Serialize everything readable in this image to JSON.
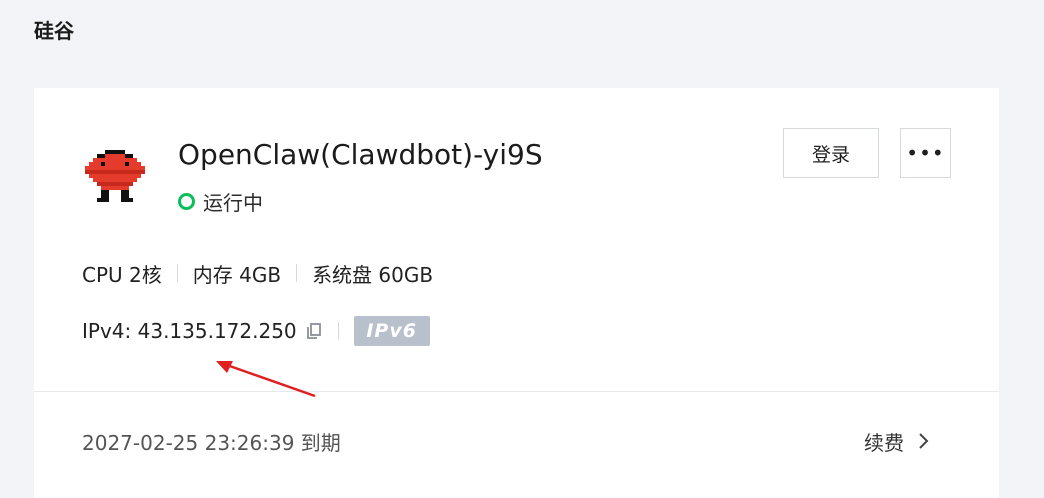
{
  "region": {
    "title": "硅谷"
  },
  "instance": {
    "name": "OpenClaw(Clawdbot)-yi9S",
    "status": "运行中",
    "status_color": "#0abf5b",
    "logo_icon": "red-mushroom-bot-icon"
  },
  "actions": {
    "login_label": "登录",
    "more_label": "•••"
  },
  "specs": {
    "cpu": "CPU 2核",
    "memory": "内存 4GB",
    "disk": "系统盘 60GB"
  },
  "network": {
    "ipv4": "IPv4: 43.135.172.250",
    "ipv6_badge": "IPv6",
    "copy_icon": "copy-icon"
  },
  "billing": {
    "expire": "2027-02-25 23:26:39 到期",
    "renew_label": "续费",
    "renew_icon": "chevron-right-icon"
  },
  "annotation": {
    "arrow_color": "#e02020"
  }
}
